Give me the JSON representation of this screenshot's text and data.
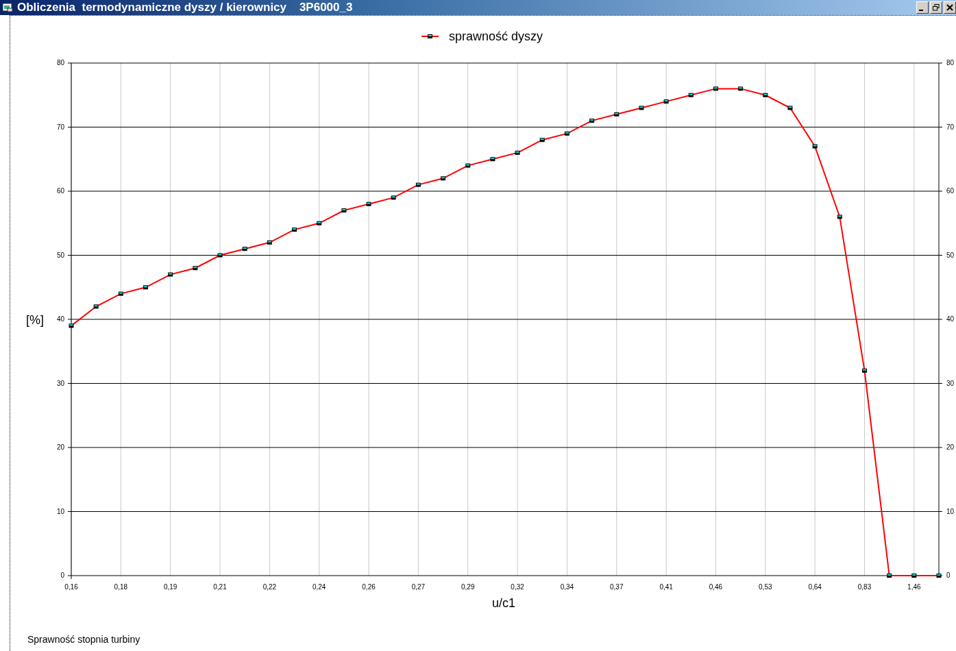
{
  "window": {
    "title": "Obliczenia  termodynamiczne dyszy / kierownicy    3P6000_3"
  },
  "chart": {
    "chart_data": {
      "type": "line",
      "xlabel": "u/c1",
      "ylabel": "[%]",
      "categories": [
        "0,16",
        null,
        "0,18",
        null,
        "0,19",
        null,
        "0,21",
        null,
        "0,22",
        null,
        "0,24",
        null,
        "0,26",
        null,
        "0,27",
        null,
        "0,29",
        null,
        "0,32",
        null,
        "0,34",
        null,
        "0,37",
        null,
        "0,41",
        null,
        "0,46",
        null,
        "0,53",
        null,
        "0,64",
        null,
        "0,83",
        null,
        "1,46",
        null
      ],
      "series": [
        {
          "name": "sprawność dyszy",
          "color": "#ff0000",
          "marker": "square",
          "values": [
            39,
            42,
            44,
            45,
            47,
            48,
            50,
            51,
            52,
            54,
            55,
            57,
            58,
            59,
            61,
            62,
            64,
            65,
            66,
            68,
            69,
            71,
            72,
            73,
            74,
            75,
            76,
            76,
            75,
            73,
            67,
            56,
            32,
            0,
            0,
            0
          ]
        }
      ],
      "ylim": [
        0,
        80
      ],
      "grid": true,
      "yticks": [
        0,
        10,
        20,
        30,
        40,
        50,
        60,
        70,
        80
      ]
    },
    "right_axis_labels": [
      "80",
      "70",
      "60",
      "50",
      "40",
      "30",
      "20",
      "10",
      "0"
    ]
  },
  "caption": "Sprawność stopnia turbiny"
}
